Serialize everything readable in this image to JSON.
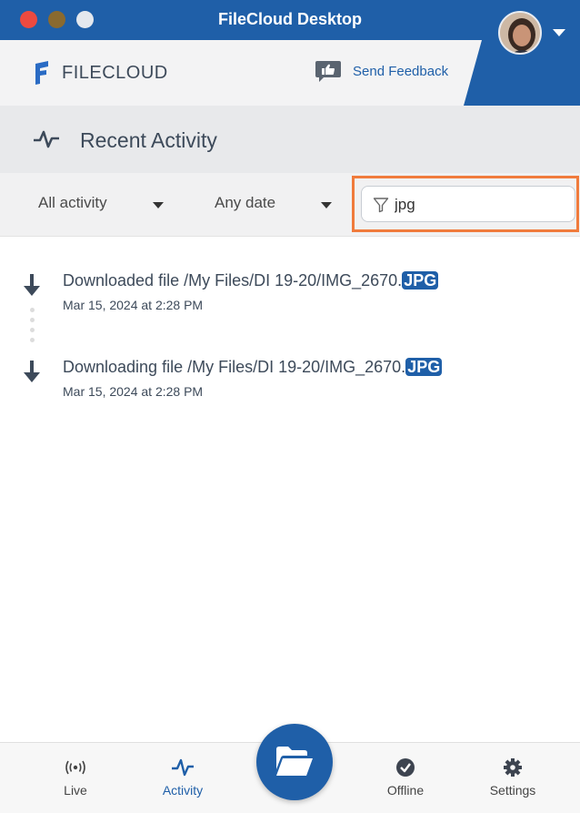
{
  "window": {
    "title": "FileCloud Desktop"
  },
  "header": {
    "logo_text": "FILECLOUD",
    "feedback_label": "Send Feedback"
  },
  "section": {
    "title": "Recent Activity"
  },
  "filters": {
    "activity_selected": "All activity",
    "date_selected": "Any date",
    "search_value": "jpg"
  },
  "activities": [
    {
      "message_prefix": "Downloaded file /My Files/DI 19-20/IMG_2670.",
      "highlight": "JPG",
      "time": "Mar 15, 2024 at 2:28 PM",
      "icon": "download-arrow-icon"
    },
    {
      "message_prefix": "Downloading file /My Files/DI 19-20/IMG_2670.",
      "highlight": "JPG",
      "time": "Mar 15, 2024 at 2:28 PM",
      "icon": "download-arrow-icon"
    }
  ],
  "nav": {
    "live": "Live",
    "activity": "Activity",
    "offline": "Offline",
    "settings": "Settings"
  },
  "colors": {
    "brand": "#1f5fa8",
    "search_highlight_border": "#f07b3c",
    "traffic_red": "#ec4a40"
  }
}
